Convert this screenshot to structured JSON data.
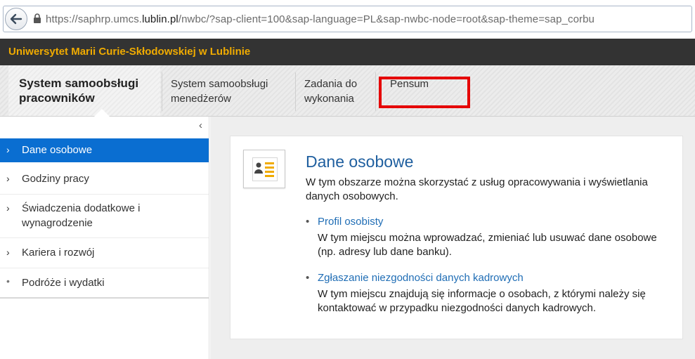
{
  "browser": {
    "url_prefix": "https://saphrp.umcs.",
    "url_domain": "lublin.pl",
    "url_suffix": "/nwbc/?sap-client=100&sap-language=PL&sap-nwbc-node=root&sap-theme=sap_corbu"
  },
  "header": {
    "title": "Uniwersytet Marii Curie-Skłodowskiej w Lublinie"
  },
  "tabs": [
    {
      "label": "System samoobsługi pracowników",
      "active": true
    },
    {
      "label": "System samoobsługi menedżerów",
      "active": false
    },
    {
      "label": "Zadania do wykonania",
      "active": false
    },
    {
      "label": "Pensum",
      "active": false
    }
  ],
  "sidebar": {
    "collapse_glyph": "‹",
    "items": [
      {
        "label": "Dane osobowe",
        "glyph": "›",
        "selected": true
      },
      {
        "label": "Godziny pracy",
        "glyph": "›"
      },
      {
        "label": "Świadczenia dodatkowe i wynagrodzenie",
        "glyph": "›"
      },
      {
        "label": "Kariera i rozwój",
        "glyph": "›"
      },
      {
        "label": "Podróże i wydatki",
        "glyph": "•"
      }
    ]
  },
  "card": {
    "icon": "contact-card-icon",
    "title": "Dane osobowe",
    "description": "W tym obszarze można skorzystać z usług opracowywania i wyświetlania danych osobowych.",
    "links": [
      {
        "bullet": "•",
        "label": "Profil osobisty",
        "description": "W tym miejscu można wprowadzać, zmieniać lub usuwać dane osobowe (np. adresy lub dane banku)."
      },
      {
        "bullet": "•",
        "label": "Zgłaszanie niezgodności danych kadrowych",
        "description": "W tym miejscu znajdują się informacje o osobach, z którymi należy się kontaktować w przypadku niezgodności danych kadrowych."
      }
    ]
  },
  "colors": {
    "accent": "#0a6ed1",
    "brand": "#f0ab00",
    "highlight": "#e50000"
  }
}
